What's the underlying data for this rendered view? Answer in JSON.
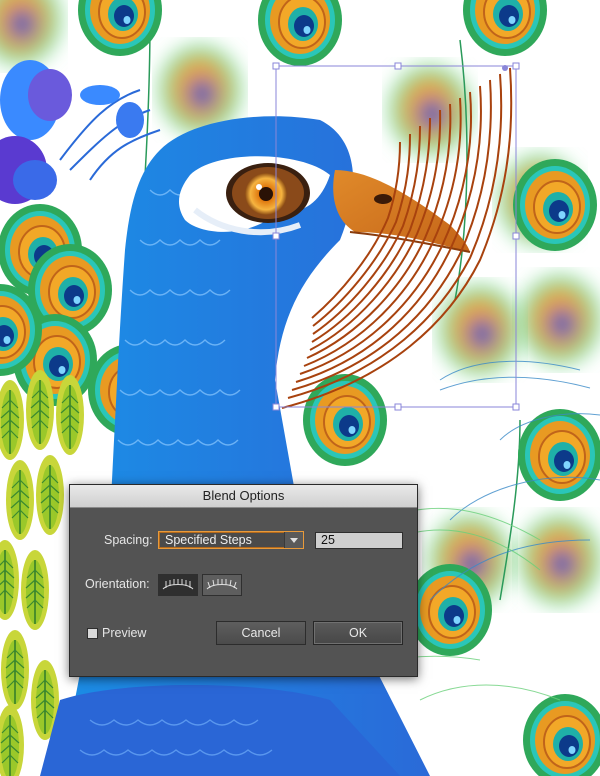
{
  "dialog": {
    "title": "Blend Options",
    "spacing_label": "Spacing:",
    "spacing_value": "Specified Steps",
    "steps_value": "25",
    "orientation_label": "Orientation:",
    "preview_label": "Preview",
    "preview_checked": false,
    "cancel_label": "Cancel",
    "ok_label": "OK"
  },
  "artwork": {
    "subject": "peacock illustration",
    "selection_color": "#8a86d8",
    "accent_colors": [
      "#1e6bdc",
      "#27c4c0",
      "#f0a020",
      "#c0501a",
      "#3bb24a"
    ]
  }
}
